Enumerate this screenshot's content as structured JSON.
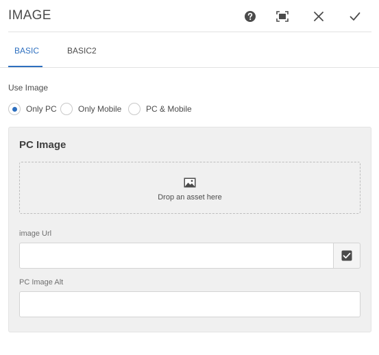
{
  "header": {
    "title": "IMAGE",
    "buttons": [
      {
        "name": "help",
        "icon": "help-icon"
      },
      {
        "name": "fullscreen",
        "icon": "fullscreen-icon"
      },
      {
        "name": "cancel",
        "icon": "close-icon"
      },
      {
        "name": "done",
        "icon": "checkmark-icon"
      }
    ]
  },
  "tabs": [
    {
      "label": "BASIC",
      "active": true
    },
    {
      "label": "BASIC2",
      "active": false
    }
  ],
  "use_image": {
    "label": "Use Image",
    "options": [
      {
        "label": "Only PC",
        "checked": true
      },
      {
        "label": "Only Mobile",
        "checked": false
      },
      {
        "label": "PC & Mobile",
        "checked": false
      }
    ]
  },
  "pc_panel": {
    "title": "PC Image",
    "dropzone": {
      "text": "Drop an asset here",
      "icon": "image-icon"
    },
    "image_url": {
      "label": "image Url",
      "value": "",
      "picker_icon": "checkbox-icon"
    },
    "alt": {
      "label": "PC Image Alt",
      "value": ""
    }
  },
  "colors": {
    "accent": "#2d6fbf",
    "panel_bg": "#f0f0f0",
    "text": "#4b4b4b"
  }
}
